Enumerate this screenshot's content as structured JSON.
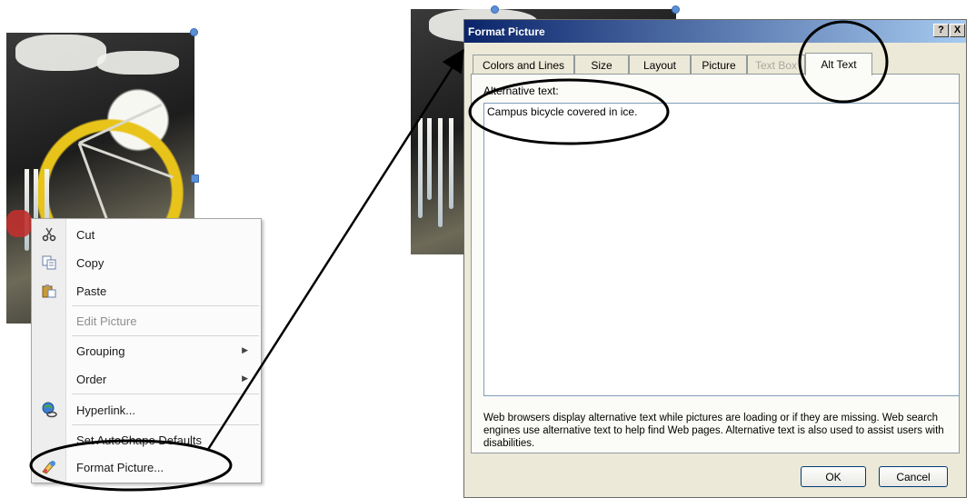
{
  "context_menu": {
    "items": [
      {
        "label": "Cut",
        "icon": "scissors-icon",
        "enabled": true,
        "submenu": false
      },
      {
        "label": "Copy",
        "icon": "copy-icon",
        "enabled": true,
        "submenu": false
      },
      {
        "label": "Paste",
        "icon": "paste-icon",
        "enabled": true,
        "submenu": false
      },
      {
        "label": "Edit Picture",
        "icon": "",
        "enabled": false,
        "submenu": false
      },
      {
        "label": "Grouping",
        "icon": "",
        "enabled": true,
        "submenu": true
      },
      {
        "label": "Order",
        "icon": "",
        "enabled": true,
        "submenu": true
      },
      {
        "label": "Hyperlink...",
        "icon": "hyperlink-icon",
        "enabled": true,
        "submenu": false
      },
      {
        "label": "Set AutoShape Defaults",
        "icon": "",
        "enabled": true,
        "submenu": false
      },
      {
        "label": "Format Picture...",
        "icon": "format-picture-icon",
        "enabled": true,
        "submenu": false
      }
    ]
  },
  "dialog": {
    "title": "Format Picture",
    "help_button": "?",
    "close_button": "X",
    "tabs": [
      {
        "label": "Colors and Lines",
        "state": "normal"
      },
      {
        "label": "Size",
        "state": "normal"
      },
      {
        "label": "Layout",
        "state": "normal"
      },
      {
        "label": "Picture",
        "state": "normal"
      },
      {
        "label": "Text Box",
        "state": "disabled"
      },
      {
        "label": "Alt Text",
        "state": "active"
      }
    ],
    "alt_label": "Alternative text:",
    "alt_text_value": "Campus bicycle covered in ice.",
    "help_text": "Web browsers display alternative text while pictures are loading or if they are missing.  Web search engines use alternative text to help find Web pages.  Alternative text is also used to assist users with disabilities.",
    "ok_label": "OK",
    "cancel_label": "Cancel"
  },
  "colors": {
    "titlebar_start": "#0a246a",
    "titlebar_end": "#a6caf0",
    "dialog_bg": "#ece9d8",
    "handle": "#5b8fd8",
    "annotation": "#000000"
  }
}
